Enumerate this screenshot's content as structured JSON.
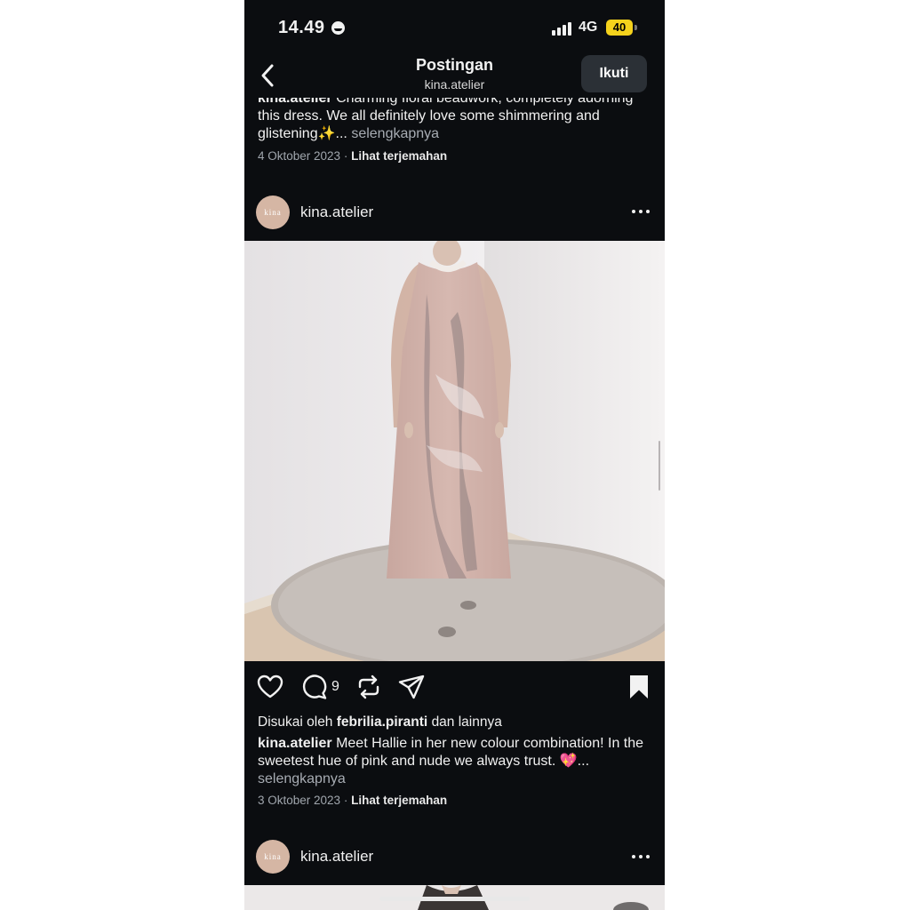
{
  "status_bar": {
    "time": "14.49",
    "network": "4G",
    "battery": "40"
  },
  "header": {
    "title": "Postingan",
    "subtitle": "kina.atelier",
    "follow_label": "Ikuti"
  },
  "posts": [
    {
      "caption_user": "kina.atelier",
      "caption_text": "Charming floral beadwork, completely adorning this dress. We all definitely love some shimmering and glistening✨...",
      "more_label": "selengkapnya",
      "date": "4 Oktober 2023",
      "translate_label": "Lihat terjemahan"
    },
    {
      "avatar_text": "kina",
      "username": "kina.atelier",
      "comment_count": "9",
      "likes_prefix": "Disukai oleh",
      "likes_user": "febrilia.piranti",
      "likes_suffix": "dan lainnya",
      "caption_user": "kina.atelier",
      "caption_text": "Meet Hallie in her new colour combination! In the sweetest hue of pink and nude we always trust. 💖...",
      "more_label": "selengkapnya",
      "date": "3 Oktober 2023",
      "translate_label": "Lihat terjemahan"
    },
    {
      "avatar_text": "kina",
      "username": "kina.atelier"
    }
  ],
  "colors": {
    "background": "#0b0d10",
    "follow_bg": "#2b3036",
    "battery": "#f5d21c",
    "avatar": "#d5b6a4"
  },
  "icons": [
    "back-icon",
    "heart-icon",
    "comment-icon",
    "repost-icon",
    "share-icon",
    "bookmark-icon",
    "more-icon"
  ]
}
